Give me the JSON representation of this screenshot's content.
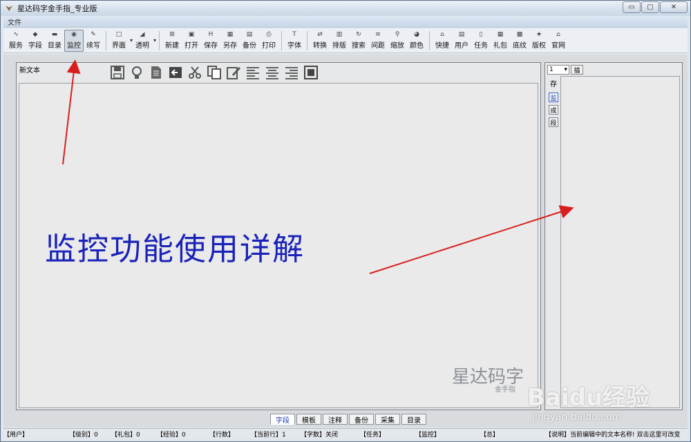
{
  "window": {
    "title": "星达码字金手指_专业版",
    "controls": {
      "minimize": "▭",
      "maximize": "▢",
      "close": "✕"
    }
  },
  "menu": {
    "file": "文件"
  },
  "toolbar": {
    "buttons": [
      {
        "label": "服务",
        "icon": "rss-icon",
        "glyph": "∿"
      },
      {
        "label": "字段",
        "icon": "diamond-icon",
        "glyph": "◆"
      },
      {
        "label": "目录",
        "icon": "folder-icon",
        "glyph": "▬"
      },
      {
        "label": "监控",
        "icon": "monitor-icon",
        "glyph": "◉"
      },
      {
        "label": "续写",
        "icon": "pen-icon",
        "glyph": "✎"
      },
      {
        "label": "界面",
        "icon": "window-icon",
        "glyph": "□"
      },
      {
        "label": "透明",
        "icon": "transparency-icon",
        "glyph": "◢"
      },
      {
        "label": "新建",
        "icon": "new-icon",
        "glyph": "⊞"
      },
      {
        "label": "打开",
        "icon": "open-icon",
        "glyph": "▣"
      },
      {
        "label": "保存",
        "icon": "save-icon",
        "glyph": "H"
      },
      {
        "label": "另存",
        "icon": "save-as-icon",
        "glyph": "▦"
      },
      {
        "label": "备份",
        "icon": "backup-icon",
        "glyph": "▤"
      },
      {
        "label": "打印",
        "icon": "print-icon",
        "glyph": "⎙"
      },
      {
        "label": "字体",
        "icon": "font-icon",
        "glyph": "T"
      },
      {
        "label": "转换",
        "icon": "convert-icon",
        "glyph": "⇄"
      },
      {
        "label": "排版",
        "icon": "layout-icon",
        "glyph": "▥"
      },
      {
        "label": "搜索",
        "icon": "refresh-icon",
        "glyph": "↻"
      },
      {
        "label": "间距",
        "icon": "spacing-icon",
        "glyph": "≡"
      },
      {
        "label": "缩放",
        "icon": "zoom-icon",
        "glyph": "⚲"
      },
      {
        "label": "颜色",
        "icon": "color-icon",
        "glyph": "◕"
      },
      {
        "label": "快捷",
        "icon": "shortcut-icon",
        "glyph": "⌂"
      },
      {
        "label": "用户",
        "icon": "user-icon",
        "glyph": "▤"
      },
      {
        "label": "任务",
        "icon": "task-icon",
        "glyph": "▯"
      },
      {
        "label": "礼包",
        "icon": "gift-icon",
        "glyph": "▦"
      },
      {
        "label": "底纹",
        "icon": "texture-icon",
        "glyph": "▩"
      },
      {
        "label": "版权",
        "icon": "star-icon",
        "glyph": "★"
      },
      {
        "label": "官网",
        "icon": "website-icon",
        "glyph": "⌂"
      }
    ]
  },
  "editor": {
    "label": "新文本",
    "content": "监控功能使用详解",
    "tools": [
      "save-icon",
      "idea-icon",
      "document-icon",
      "back-icon",
      "cut-icon",
      "copy-icon",
      "edit-icon",
      "align-left-icon",
      "align-center-icon",
      "align-right-icon",
      "fullscreen-icon"
    ],
    "watermark_main": "星达码字",
    "watermark_sub": "金手指"
  },
  "side": {
    "select_value": "1",
    "insert": "插",
    "save": "存",
    "tabs": [
      "监",
      "成",
      "段"
    ]
  },
  "bottom_tabs": [
    "字段",
    "模板",
    "注释",
    "备份",
    "采集",
    "目录"
  ],
  "status": [
    {
      "k": "【用户】",
      "v": ""
    },
    {
      "k": "【级别】",
      "v": "0"
    },
    {
      "k": "【礼包】",
      "v": "0"
    },
    {
      "k": "【经验】",
      "v": "0"
    },
    {
      "k": "【行数】",
      "v": ""
    },
    {
      "k": "【当前行】",
      "v": "1"
    },
    {
      "k": "【字数】",
      "v": "关闭"
    },
    {
      "k": "【任务】",
      "v": ""
    },
    {
      "k": "【监控】",
      "v": ""
    },
    {
      "k": "【总】",
      "v": ""
    },
    {
      "k": "【说明】",
      "v": "当前编辑中的文本名称! 双击这里可改变"
    }
  ],
  "baidu": {
    "logo": "Baidu经验",
    "url": "jingyan.baidu.com"
  }
}
